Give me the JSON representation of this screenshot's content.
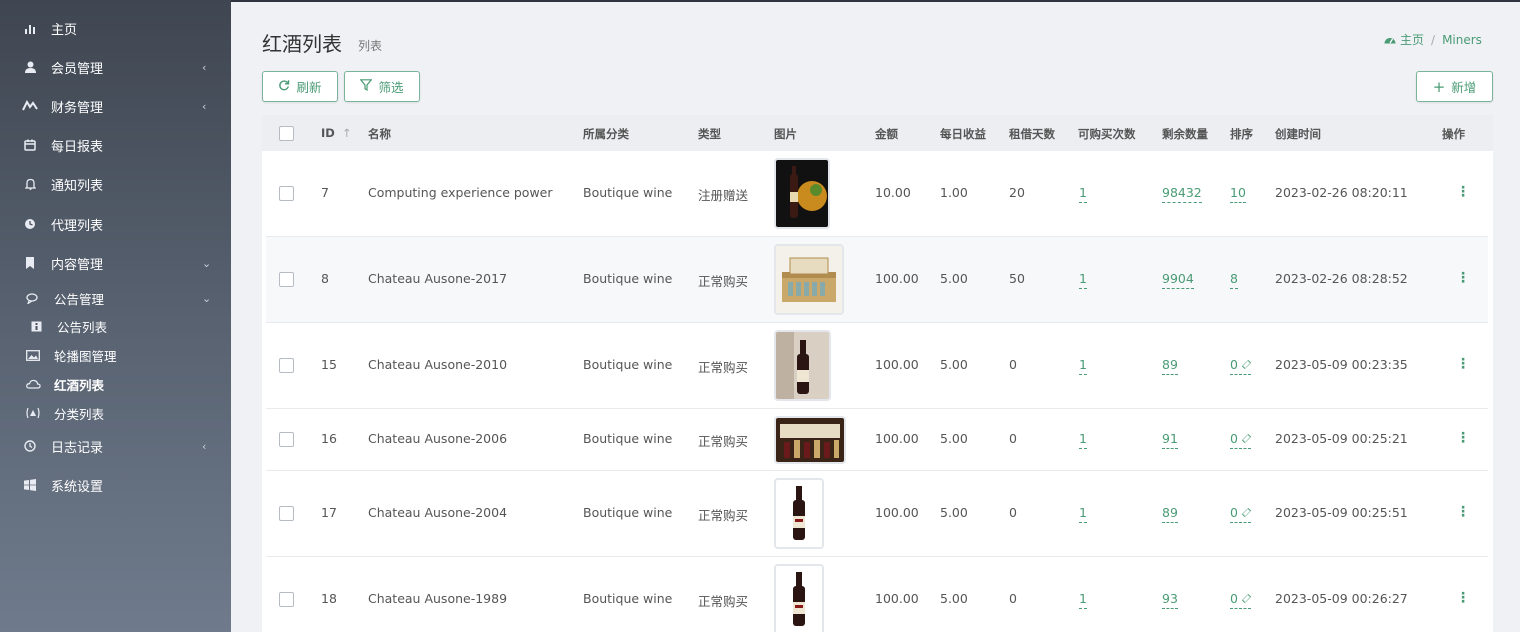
{
  "sidebar": {
    "items": [
      {
        "label": "主页",
        "icon": "bar-chart-icon"
      },
      {
        "label": "会员管理",
        "icon": "user-icon"
      },
      {
        "label": "财务管理",
        "icon": "finance-icon"
      },
      {
        "label": "每日报表",
        "icon": "calendar-icon"
      },
      {
        "label": "通知列表",
        "icon": "bell-icon"
      },
      {
        "label": "代理列表",
        "icon": "circle-icon"
      },
      {
        "label": "内容管理",
        "icon": "bookmark-icon"
      },
      {
        "label": "公告管理",
        "icon": "comments-icon"
      },
      {
        "label": "公告列表",
        "icon": "info-icon"
      },
      {
        "label": "轮播图管理",
        "icon": "image-icon"
      },
      {
        "label": "红酒列表",
        "icon": "cloud-icon"
      },
      {
        "label": "分类列表",
        "icon": "category-icon"
      },
      {
        "label": "日志记录",
        "icon": "clock-icon"
      },
      {
        "label": "系统设置",
        "icon": "windows-icon"
      }
    ]
  },
  "header": {
    "title": "红酒列表",
    "subtitle": "列表",
    "breadcrumb": {
      "home": "主页",
      "current": "Miners"
    }
  },
  "toolbar": {
    "refresh": "刷新",
    "filter": "筛选",
    "add": "新增"
  },
  "table": {
    "columns": [
      "ID",
      "名称",
      "所属分类",
      "类型",
      "图片",
      "金额",
      "每日收益",
      "租借天数",
      "可购买次数",
      "剩余数量",
      "排序",
      "创建时间",
      "操作"
    ],
    "rows": [
      {
        "id": "7",
        "name": "Computing experience power",
        "category": "Boutique wine",
        "type": "注册赠送",
        "amount": "10.00",
        "daily": "1.00",
        "days": "20",
        "buy_times": "1",
        "remaining": "98432",
        "sort": "10",
        "created": "2023-02-26 08:20:11"
      },
      {
        "id": "8",
        "name": "Chateau Ausone-2017",
        "category": "Boutique wine",
        "type": "正常购买",
        "amount": "100.00",
        "daily": "5.00",
        "days": "50",
        "buy_times": "1",
        "remaining": "9904",
        "sort": "8",
        "created": "2023-02-26 08:28:52"
      },
      {
        "id": "15",
        "name": "Chateau Ausone-2010",
        "category": "Boutique wine",
        "type": "正常购买",
        "amount": "100.00",
        "daily": "5.00",
        "days": "0",
        "buy_times": "1",
        "remaining": "89",
        "sort": "0",
        "created": "2023-05-09 00:23:35"
      },
      {
        "id": "16",
        "name": "Chateau Ausone-2006",
        "category": "Boutique wine",
        "type": "正常购买",
        "amount": "100.00",
        "daily": "5.00",
        "days": "0",
        "buy_times": "1",
        "remaining": "91",
        "sort": "0",
        "created": "2023-05-09 00:25:21"
      },
      {
        "id": "17",
        "name": "Chateau Ausone-2004",
        "category": "Boutique wine",
        "type": "正常购买",
        "amount": "100.00",
        "daily": "5.00",
        "days": "0",
        "buy_times": "1",
        "remaining": "89",
        "sort": "0",
        "created": "2023-05-09 00:25:51"
      },
      {
        "id": "18",
        "name": "Chateau Ausone-1989",
        "category": "Boutique wine",
        "type": "正常购买",
        "amount": "100.00",
        "daily": "5.00",
        "days": "0",
        "buy_times": "1",
        "remaining": "93",
        "sort": "0",
        "created": "2023-05-09 00:26:27"
      }
    ]
  },
  "colors": {
    "accent": "#4a9b75",
    "sidebar": "#4a525e",
    "background": "#f0f1f5"
  }
}
